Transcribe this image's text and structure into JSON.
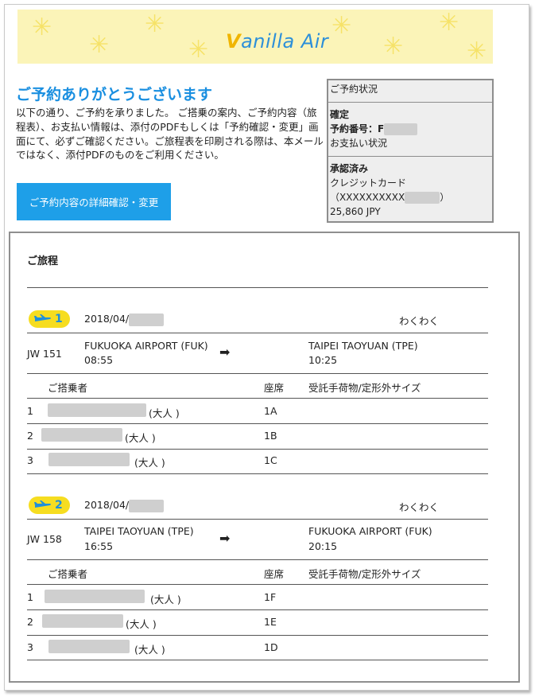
{
  "brand": {
    "name_v": "V",
    "name_rest": "anilla",
    "name_air": " Air"
  },
  "header": {
    "title": "ご予約ありがとうございます",
    "intro": "以下の通り、ご予約を承りました。 ご搭乗の案内、ご予約内容（旅程表）、お支払い情報は、添付のPDFもしくは「予約確認・変更」画面にて、必ずご確認ください。ご旅程表を印刷される際は、本メールではなく、添付PDFのものをご利用ください。",
    "button": "ご予約内容の詳細確認・変更"
  },
  "status_box": {
    "title": "ご予約状況",
    "confirmed": "確定",
    "booking_label": "予約番号：F",
    "payment_status": "お支払い状況",
    "approved": "承認済み",
    "card": "クレジットカード",
    "card_number": "（XXXXXXXXXX",
    "card_close": "）",
    "amount": "25,860 JPY"
  },
  "itinerary": {
    "title": "ご旅程",
    "passenger_header": "ご搭乗者",
    "seat_header": "座席",
    "baggage_header": "受託手荷物/定形外サイズ",
    "adult": "(大人 )",
    "flights": [
      {
        "num": "1",
        "date": "2018/04/",
        "fare": "わくわく",
        "flight_no": "JW 151",
        "from": "FUKUOKA AIRPORT (FUK)",
        "dep": "08:55",
        "to": "TAIPEI TAOYUAN (TPE)",
        "arr": "10:25",
        "passengers": [
          {
            "idx": "1",
            "seat": "1A"
          },
          {
            "idx": "2",
            "seat": "1B"
          },
          {
            "idx": "3",
            "seat": "1C"
          }
        ]
      },
      {
        "num": "2",
        "date": "2018/04/",
        "fare": "わくわく",
        "flight_no": "JW 158",
        "from": "TAIPEI TAOYUAN (TPE)",
        "dep": "16:55",
        "to": "FUKUOKA AIRPORT (FUK)",
        "arr": "20:15",
        "passengers": [
          {
            "idx": "1",
            "seat": "1F"
          },
          {
            "idx": "2",
            "seat": "1E"
          },
          {
            "idx": "3",
            "seat": "1D"
          }
        ]
      }
    ]
  },
  "colors": {
    "accent": "#1e9fe8",
    "badge": "#f6dd20",
    "banner": "#fbf4b8"
  },
  "icons": {
    "plane": "plane-icon",
    "arrow": "arrow-right-icon"
  }
}
